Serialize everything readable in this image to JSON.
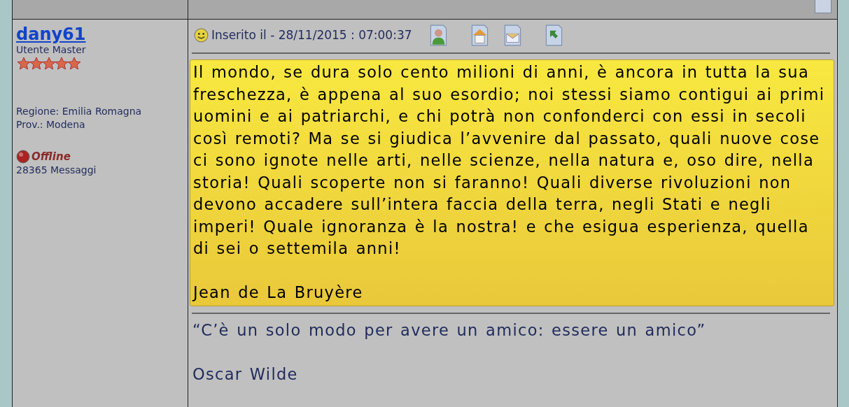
{
  "author": {
    "name": "dany61",
    "rank": "Utente Master",
    "stars": 5,
    "region": "Regione: Emilia Romagna",
    "province": "Prov.: Modena",
    "status": "Offline",
    "online": false,
    "messages": "28365 Messaggi"
  },
  "post": {
    "posted": "Inserito il - 28/11/2015 : 07:00:37",
    "paragraphs": [
      "Il mondo, se dura solo cento milioni di anni, è ancora in tutta la sua freschezza, è appena al suo esordio; noi stessi siamo contigui ai primi uomini e ai patriarchi, e chi potrà non confonderci con essi in secoli così remoti? Ma se si giudica l’avvenire dal passato, quali nuove cose ci sono ignote nelle arti, nelle scienze, nella natura e, oso dire, nella storia! Quali scoperte non si faranno! Quali diverse rivoluzioni non devono accadere sull’intera faccia della terra, negli Stati e negli imperi! Quale ignoranza è la nostra! e che esigua esperienza, quella di sei o settemila anni!",
      "Jean de La Bruyère"
    ],
    "signature": [
      "“C’è un solo modo per avere un amico: essere un amico”",
      "Oscar Wilde"
    ]
  }
}
